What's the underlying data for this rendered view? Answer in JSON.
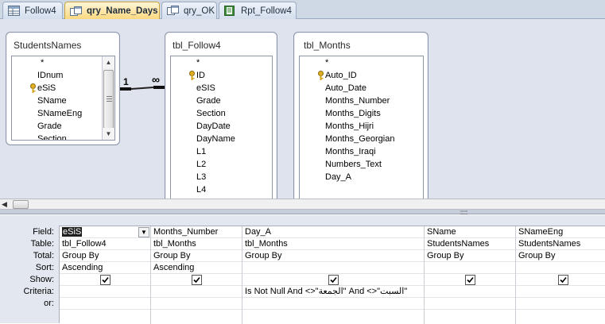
{
  "tabs": [
    {
      "label": "Follow4",
      "icon": "table-icon",
      "active": false
    },
    {
      "label": "qry_Name_Days",
      "icon": "query-icon",
      "active": true
    },
    {
      "label": "qry_OK",
      "icon": "query-icon",
      "active": false
    },
    {
      "label": "Rpt_Follow4",
      "icon": "report-icon",
      "active": false
    }
  ],
  "tables": {
    "studentsnames": {
      "title": "StudentsNames",
      "fields": [
        "*",
        "IDnum",
        "eSiS",
        "SName",
        "SNameEng",
        "Grade",
        "Section"
      ],
      "key_field": "eSiS"
    },
    "tbl_follow4": {
      "title": "tbl_Follow4",
      "fields": [
        "*",
        "ID",
        "eSIS",
        "Grade",
        "Section",
        "DayDate",
        "DayName",
        "L1",
        "L2",
        "L3",
        "L4"
      ],
      "key_field": "ID"
    },
    "tbl_months": {
      "title": "tbl_Months",
      "fields": [
        "*",
        "Auto_ID",
        "Auto_Date",
        "Months_Number",
        "Months_Digits",
        "Months_Hijri",
        "Months_Georgian",
        "Months_Iraqi",
        "Numbers_Text",
        "Day_A"
      ],
      "key_field": "Auto_ID"
    }
  },
  "join": {
    "one_label": "1",
    "many_label": "∞"
  },
  "grid": {
    "row_labels": [
      "Field:",
      "Table:",
      "Total:",
      "Sort:",
      "Show:",
      "Criteria:",
      "or:"
    ],
    "columns": [
      {
        "field": "eSiS",
        "table": "tbl_Follow4",
        "total": "Group By",
        "sort": "Ascending",
        "show": true,
        "criteria": ""
      },
      {
        "field": "Months_Number",
        "table": "tbl_Months",
        "total": "Group By",
        "sort": "Ascending",
        "show": true,
        "criteria": ""
      },
      {
        "field": "Day_A",
        "table": "tbl_Months",
        "total": "Group By",
        "sort": "",
        "show": true,
        "criteria": "Is Not Null And <>\"الجمعة\" And <>\"السبت\""
      },
      {
        "field": "SName",
        "table": "StudentsNames",
        "total": "Group By",
        "sort": "",
        "show": true,
        "criteria": ""
      },
      {
        "field": "SNameEng",
        "table": "StudentsNames",
        "total": "Group By",
        "sort": "",
        "show": true,
        "criteria": ""
      }
    ]
  },
  "colors": {
    "design_bg": "#dfe3ee",
    "active_tab": "#fbd77b",
    "grid_bg": "#e3e7ef"
  }
}
